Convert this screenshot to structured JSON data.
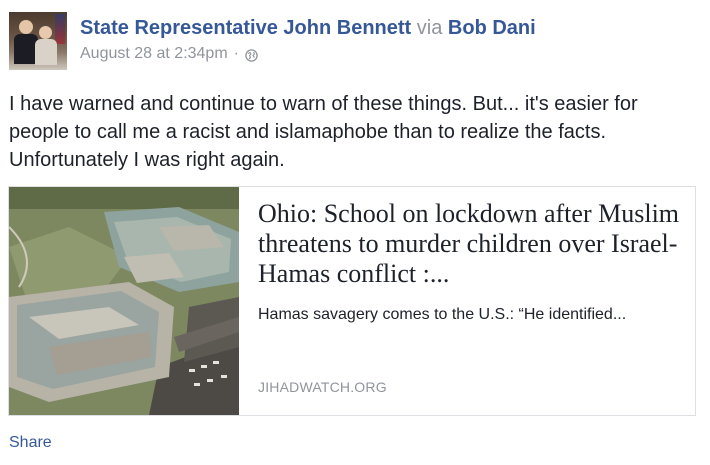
{
  "post": {
    "author": "State Representative John Bennett",
    "via_label": "via",
    "via_name": "Bob Dani",
    "timestamp": "August 28 at 2:34pm",
    "separator": "·",
    "privacy_icon": "globe-icon",
    "message": "I have warned and continue to warn of these things. But... it's easier for people to call me a racist and islamaphobe than to realize the facts. Unfortunately I was right again."
  },
  "link_card": {
    "title": "Ohio: School on lockdown after Muslim threatens to murder children over Israel-Hamas conflict :...",
    "description": "Hamas savagery comes to the U.S.: “He identified...",
    "domain": "JIHADWATCH.ORG"
  },
  "actions": {
    "share_label": "Share"
  },
  "colors": {
    "link_blue": "#365899",
    "meta_gray": "#90949c",
    "text": "#1d2129",
    "border": "#dddfe2"
  }
}
